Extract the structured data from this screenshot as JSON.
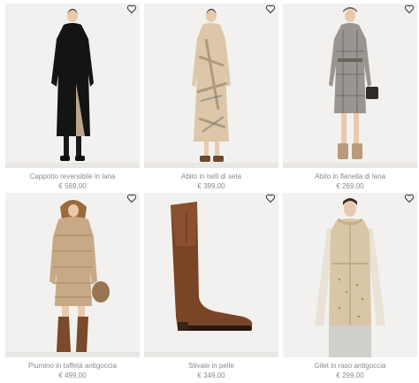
{
  "products": [
    {
      "name": "Cappotto reversibile in lana",
      "price": "€ 569,00"
    },
    {
      "name": "Abito in twill di seta",
      "price": "€ 399,00"
    },
    {
      "name": "Abito in flanella di lana",
      "price": "€ 269,00"
    },
    {
      "name": "Piumino in taffetà antigoccia",
      "price": "€ 499,00"
    },
    {
      "name": "Stivale in pelle",
      "price": "€ 349,00"
    },
    {
      "name": "Gilet in raso antigoccia",
      "price": "€ 299,00"
    }
  ],
  "icons": {
    "favorite": "heart-outline-icon"
  },
  "colors": {
    "caption_text": "#8a8a8a",
    "photo_bg": "#f2f1ef"
  }
}
